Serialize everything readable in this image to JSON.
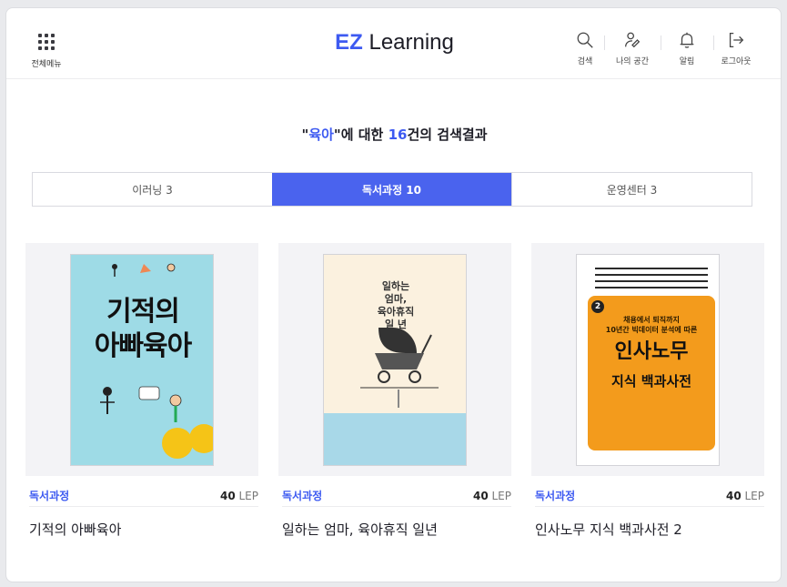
{
  "header": {
    "menu_label": "전체메뉴",
    "logo_prefix": "EZ",
    "logo_text": " Learning",
    "tools": [
      {
        "label": "검색",
        "icon": "search-icon"
      },
      {
        "label": "나의 공간",
        "icon": "pencil-user-icon"
      },
      {
        "label": "알림",
        "icon": "bell-icon"
      },
      {
        "label": "로그아웃",
        "icon": "logout-icon"
      }
    ]
  },
  "result": {
    "open_quote": "\"",
    "keyword": "육아",
    "mid": "\"에 대한 ",
    "count": "16",
    "suffix": "건의 검색결과"
  },
  "tabs": [
    {
      "label": "이러닝 3",
      "active": false
    },
    {
      "label": "독서과정 10",
      "active": true
    },
    {
      "label": "운영센터 3",
      "active": false
    }
  ],
  "cards": [
    {
      "category": "독서과정",
      "lep_value": "40",
      "lep_unit": " LEP",
      "title": "기적의 아빠육아",
      "cover": {
        "title_line1": "기적의",
        "title_line2": "아빠육아"
      }
    },
    {
      "category": "독서과정",
      "lep_value": "40",
      "lep_unit": " LEP",
      "title": "일하는 엄마, 육아휴직 일년",
      "cover": {
        "title_line1": "일하는",
        "title_line2": "엄마,",
        "title_line3": "육아휴직",
        "title_line4": "일 년"
      }
    },
    {
      "category": "독서과정",
      "lep_value": "40",
      "lep_unit": " LEP",
      "title": "인사노무 지식 백과사전 2",
      "cover": {
        "num": "2",
        "sub_line1": "채용에서 퇴직까지",
        "sub_line2": "10년간 빅데이터 분석에 따른",
        "title_line1": "인사노무",
        "title_line2": "지식 백과사전"
      }
    }
  ]
}
